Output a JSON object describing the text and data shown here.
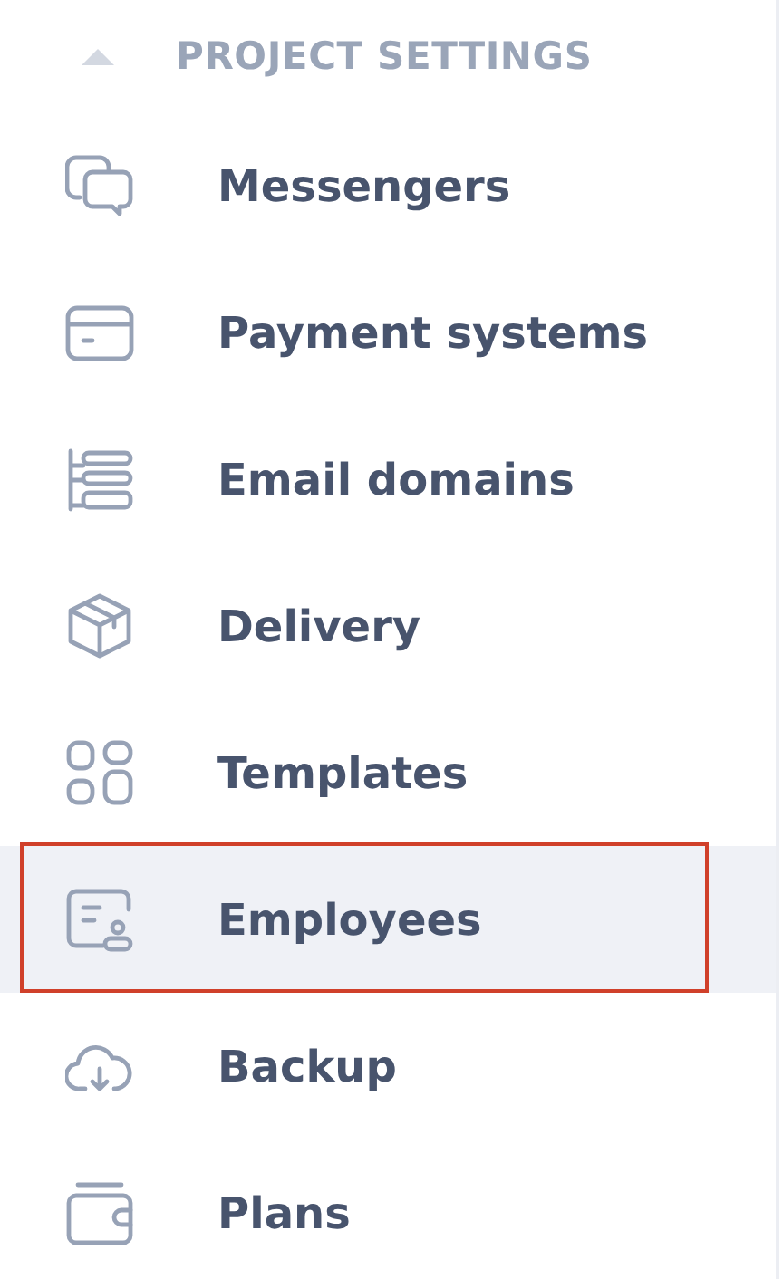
{
  "section": {
    "title": "PROJECT SETTINGS",
    "expanded": true
  },
  "items": [
    {
      "label": "Messengers",
      "selected": false,
      "outlined": false
    },
    {
      "label": "Payment systems",
      "selected": false,
      "outlined": false
    },
    {
      "label": "Email domains",
      "selected": false,
      "outlined": false
    },
    {
      "label": "Delivery",
      "selected": false,
      "outlined": false
    },
    {
      "label": "Templates",
      "selected": false,
      "outlined": false
    },
    {
      "label": "Employees",
      "selected": true,
      "outlined": true
    },
    {
      "label": "Backup",
      "selected": false,
      "outlined": false
    },
    {
      "label": "Plans",
      "selected": false,
      "outlined": false
    }
  ]
}
